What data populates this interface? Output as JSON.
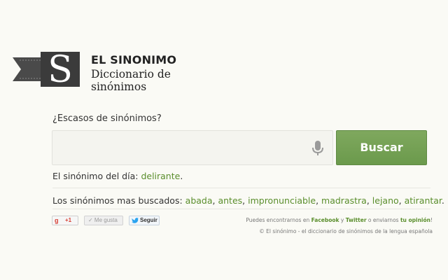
{
  "brand": {
    "logo_letter": "S",
    "title": "EL SINONIMO",
    "subtitle": "Diccionario de sinónimos"
  },
  "search": {
    "question": "¿Escasos de sinónimos?",
    "value": "",
    "placeholder": "",
    "button_label": "Buscar"
  },
  "daily": {
    "label": "El sinónimo del día:",
    "word": "delirante",
    "end": "."
  },
  "popular": {
    "label": "Los sinónimos mas buscados:",
    "words": [
      "abada",
      "antes",
      "impronunciable",
      "madrastra",
      "lejano",
      "atirantar"
    ],
    "sep": ", ",
    "end": "."
  },
  "social": {
    "gplus_g": "g",
    "gplus_count": "+1",
    "like_label": "✓ Me gusta",
    "follow_label": "Seguir"
  },
  "footer": {
    "text1": "Puedes encontrarnos en ",
    "facebook": "Facebook",
    "text2": " y ",
    "twitter": "Twitter",
    "text3": " o enviarnos ",
    "opinion": "tu opinión",
    "text4": "!",
    "copyright": "© El sinónimo - el diccionario de sinónimos de la lengua española"
  },
  "colors": {
    "accent_green": "#6b9a4c",
    "link_green": "#5a8e2c",
    "background": "#fafaf5"
  }
}
